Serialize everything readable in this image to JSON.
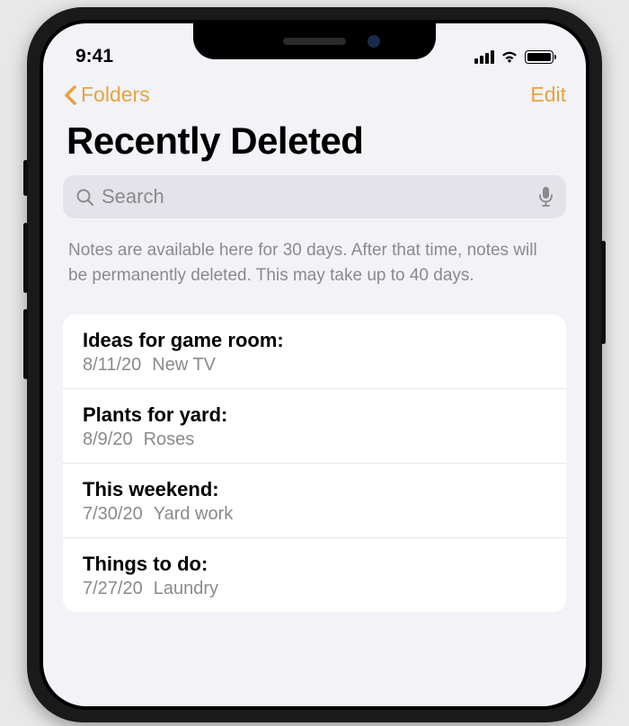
{
  "status": {
    "time": "9:41"
  },
  "nav": {
    "back_label": "Folders",
    "edit_label": "Edit"
  },
  "page": {
    "title": "Recently Deleted"
  },
  "search": {
    "placeholder": "Search"
  },
  "info": "Notes are available here for 30 days. After that time, notes will be permanently deleted. This may take up to 40 days.",
  "notes": [
    {
      "title": "Ideas for game room:",
      "date": "8/11/20",
      "preview": "New TV"
    },
    {
      "title": "Plants for yard:",
      "date": "8/9/20",
      "preview": "Roses"
    },
    {
      "title": "This weekend:",
      "date": "7/30/20",
      "preview": "Yard work"
    },
    {
      "title": "Things to do:",
      "date": "7/27/20",
      "preview": "Laundry"
    }
  ],
  "colors": {
    "accent": "#e8a33d"
  }
}
